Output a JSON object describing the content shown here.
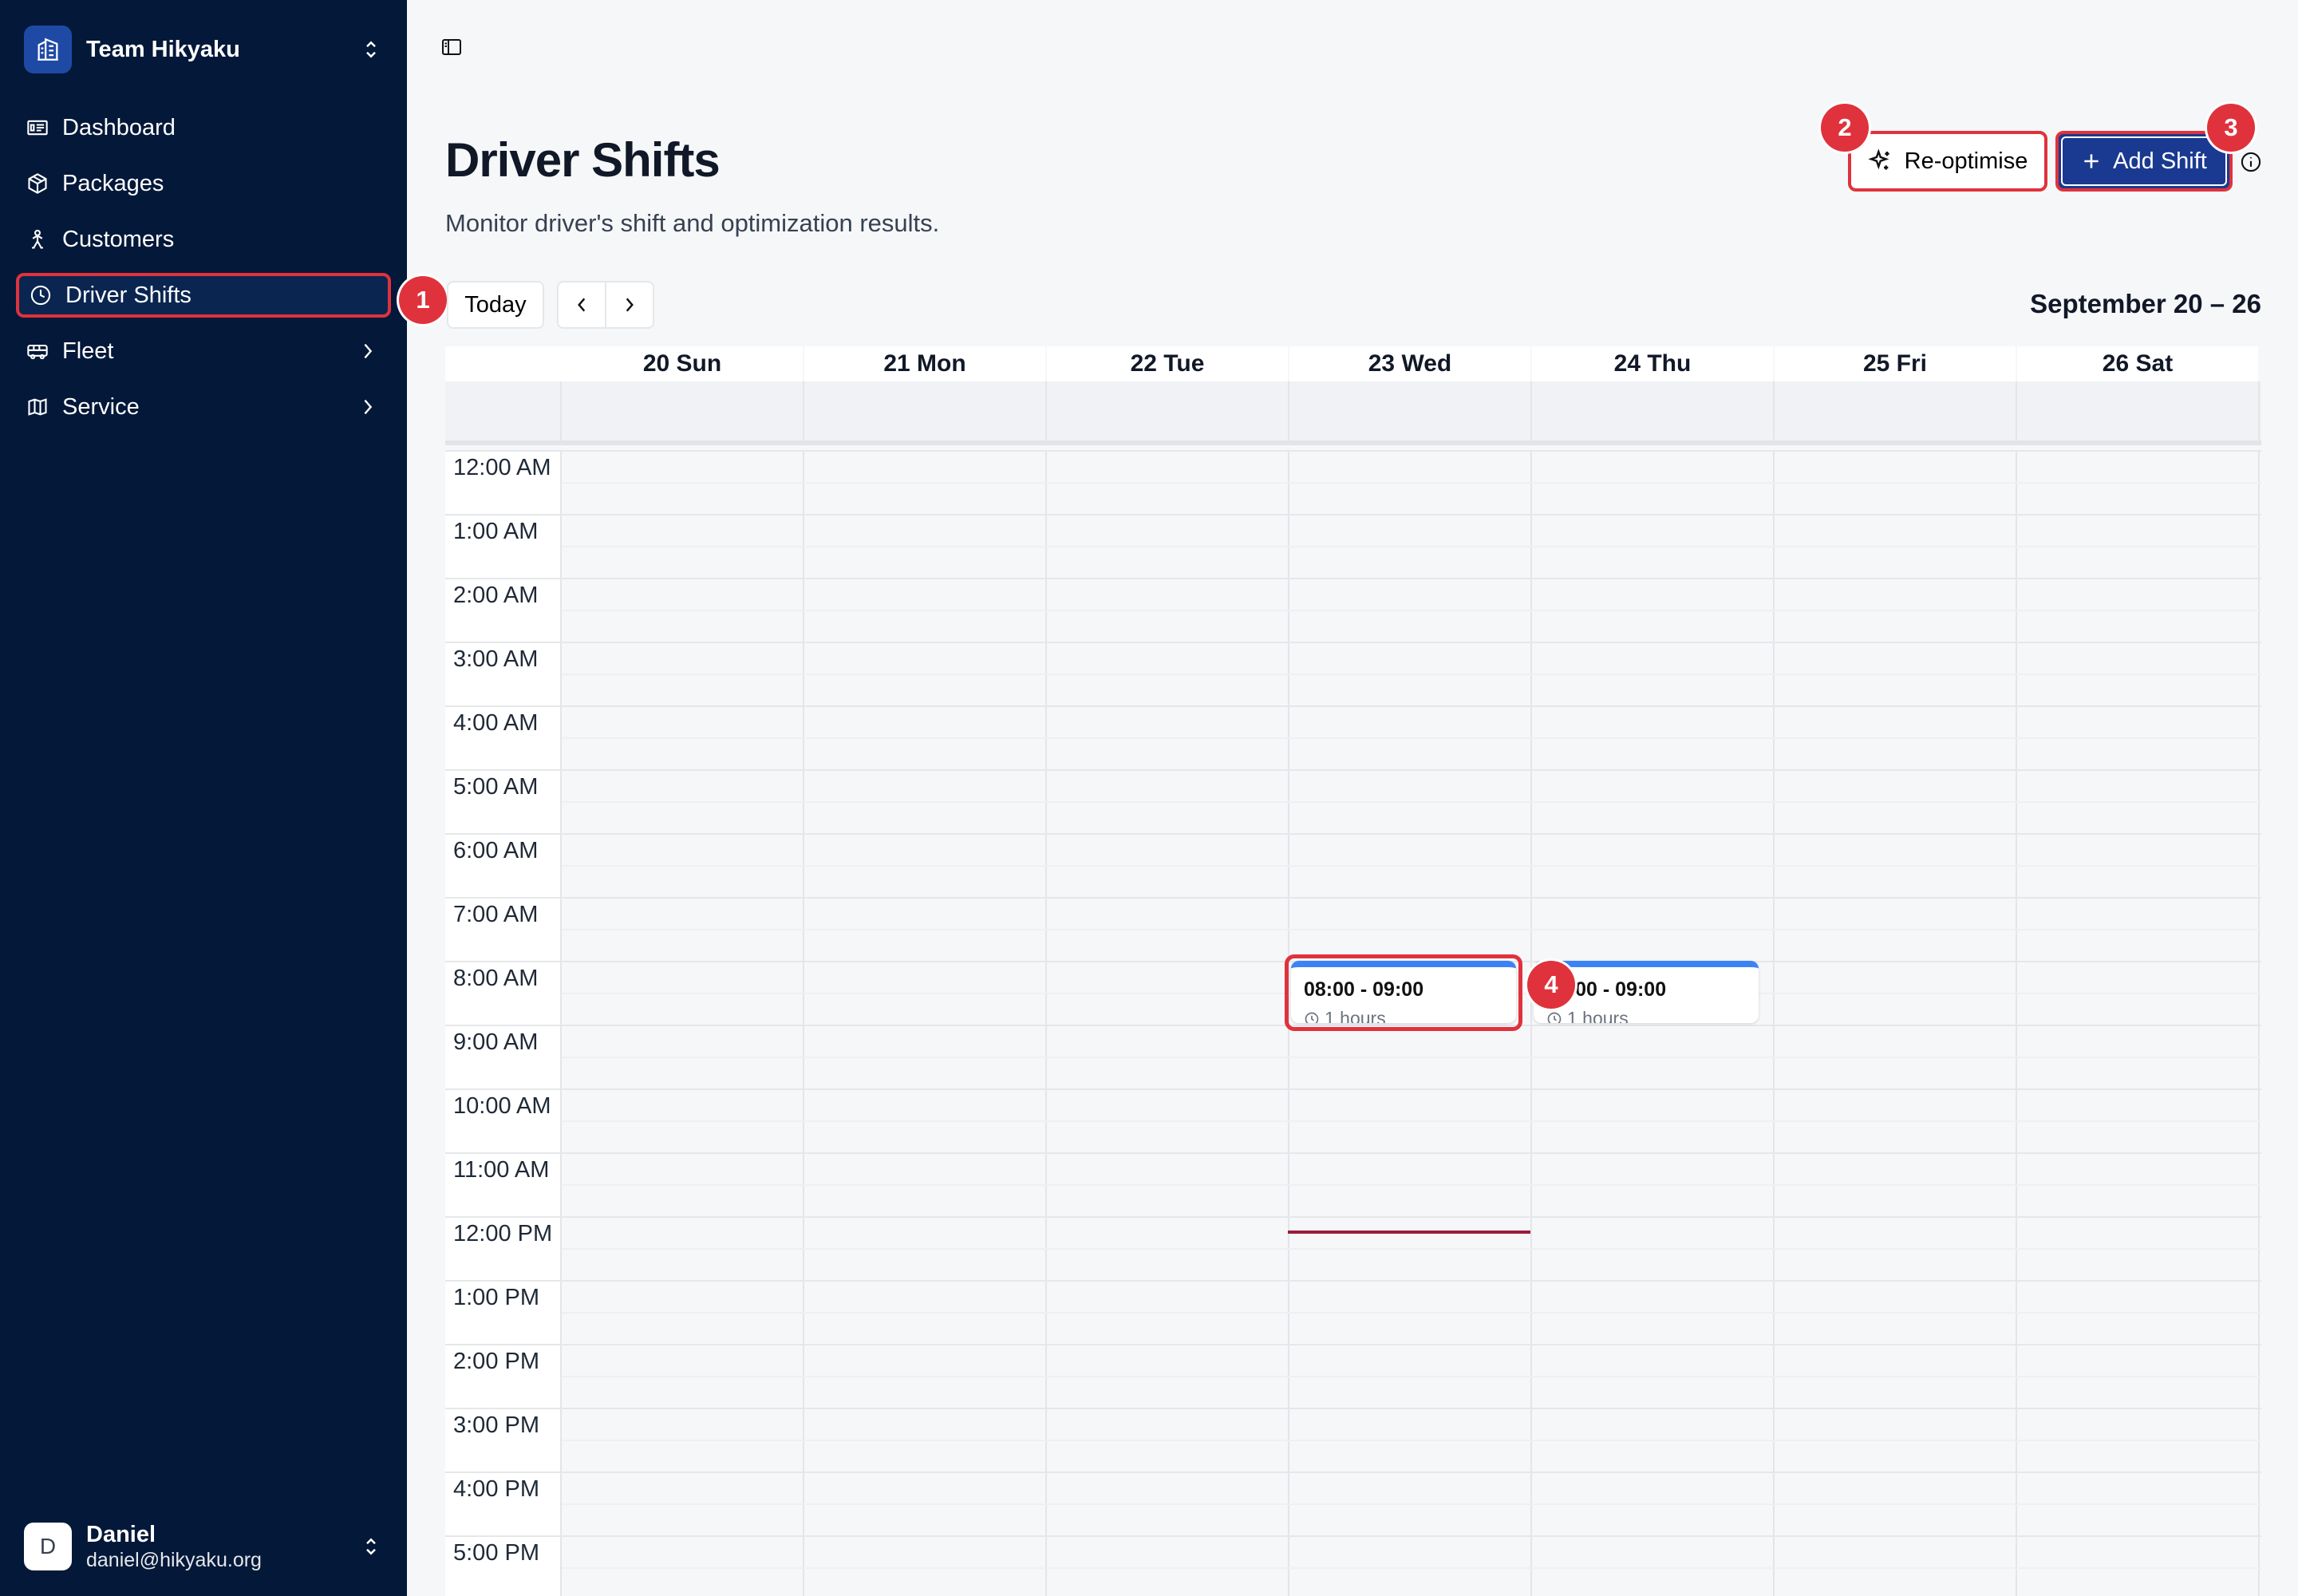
{
  "sidebar": {
    "team_name": "Team Hikyaku",
    "nav": [
      {
        "label": "Dashboard",
        "icon": "dashboard-icon"
      },
      {
        "label": "Packages",
        "icon": "package-icon"
      },
      {
        "label": "Customers",
        "icon": "person-icon"
      },
      {
        "label": "Driver Shifts",
        "icon": "clock-icon",
        "active": true
      },
      {
        "label": "Fleet",
        "icon": "truck-icon",
        "has_children": true
      },
      {
        "label": "Service",
        "icon": "map-icon",
        "has_children": true
      }
    ],
    "user": {
      "initial": "D",
      "name": "Daniel",
      "email": "daniel@hikyaku.org"
    }
  },
  "header": {
    "title": "Driver Shifts",
    "subtitle": "Monitor driver's shift and optimization results.",
    "reoptimise_label": "Re-optimise",
    "add_shift_label": "Add Shift"
  },
  "toolbar": {
    "today_label": "Today",
    "range_label": "September 20 – 26"
  },
  "calendar": {
    "days": [
      "20 Sun",
      "21 Mon",
      "22 Tue",
      "23 Wed",
      "24 Thu",
      "25 Fri",
      "26 Sat"
    ],
    "hours": [
      "12:00 AM",
      "1:00 AM",
      "2:00 AM",
      "3:00 AM",
      "4:00 AM",
      "5:00 AM",
      "6:00 AM",
      "7:00 AM",
      "8:00 AM",
      "9:00 AM",
      "10:00 AM",
      "11:00 AM",
      "12:00 PM",
      "1:00 PM",
      "2:00 PM",
      "3:00 PM",
      "4:00 PM",
      "5:00 PM"
    ],
    "events": [
      {
        "time": "08:00 - 09:00",
        "duration": "1 hours",
        "day": "23 Wed"
      },
      {
        "time": "08:00 - 09:00",
        "duration": "1 hours",
        "day": "24 Thu"
      }
    ],
    "current_time": "12:15 PM"
  },
  "annotations": [
    "1",
    "2",
    "3",
    "4"
  ],
  "colors": {
    "sidebar_bg": "#041839",
    "primary": "#1a3990",
    "highlight": "#e0323c",
    "event_accent": "#3b82f6",
    "now_line": "#9b1c3a"
  }
}
